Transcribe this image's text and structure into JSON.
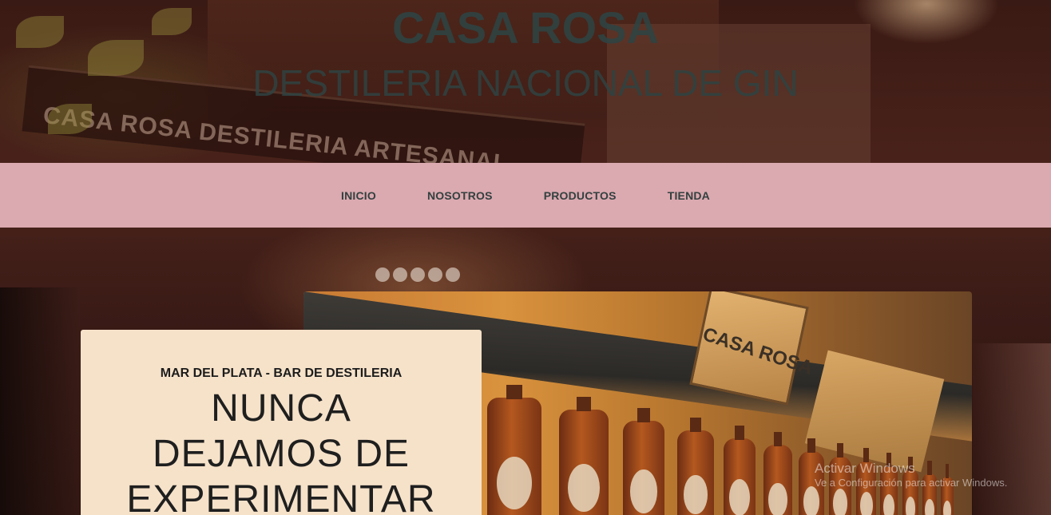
{
  "header": {
    "title": "CASA ROSA",
    "subtitle": "DESTILERIA NACIONAL DE GIN"
  },
  "background": {
    "sign_text": "CASA ROSA DESTILERIA ARTESANAL"
  },
  "nav": {
    "items": [
      {
        "label": "INICIO"
      },
      {
        "label": "NOSOTROS"
      },
      {
        "label": "PRODUCTOS"
      },
      {
        "label": "TIENDA"
      }
    ]
  },
  "hero": {
    "kicker": "MAR DEL PLATA - BAR DE DESTILERIA",
    "heading": "NUNCA DEJAMOS DE EXPERIMENTAR",
    "photo_crate_label": "CASA ROSA"
  },
  "os_watermark": {
    "title": "Activar Windows",
    "subtitle": "Ve a Configuración para activar Windows."
  },
  "colors": {
    "nav_background": "#dba9b0",
    "card_background": "#f6e2c9",
    "title_color": "#2f4342"
  }
}
